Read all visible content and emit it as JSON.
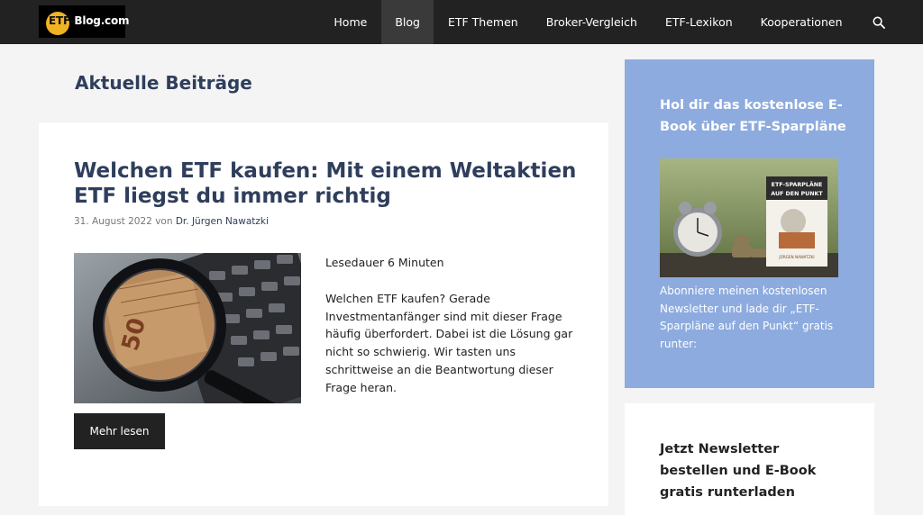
{
  "header": {
    "logo_prefix": "ETF-",
    "logo_suffix": "Blog.com",
    "nav": [
      {
        "label": "Home"
      },
      {
        "label": "Blog"
      },
      {
        "label": "ETF Themen"
      },
      {
        "label": "Broker-Vergleich"
      },
      {
        "label": "ETF-Lexikon"
      },
      {
        "label": "Kooperationen"
      }
    ],
    "active_nav": "Blog",
    "search_icon": "search-icon"
  },
  "main": {
    "page_title": "Aktuelle Beiträge",
    "post": {
      "title": "Welchen ETF kaufen: Mit einem Weltaktien ETF liegst du immer richtig",
      "date": "31. August 2022",
      "by": "von",
      "author": "Dr. Jürgen Nawatzki",
      "read_time": "Lesedauer 6 Minuten",
      "excerpt": "Welchen ETF kaufen? Gerade Investmentanfänger sind mit dieser Frage häufig überfordert. Dabei ist die Lösung gar nicht so schwierig. Wir tasten uns schrittweise an die Beantwortung dieser Frage heran.",
      "more_label": "Mehr lesen"
    }
  },
  "sidebar": {
    "ebook": {
      "title": "Hol dir das kostenlose E-Book über ETF-Sparpläne",
      "book_cover_line1": "ETF-SPARPLÄNE",
      "book_cover_line2": "AUF DEN PUNKT",
      "book_cover_author": "JÜRGEN NAWATZKI",
      "text": "Abonniere meinen kostenlosen Newsletter und lade dir „ETF-Sparpläne auf den Punkt“ gratis runter:"
    },
    "newsletter": {
      "title": "Jetzt Newsletter bestellen und E-Book gratis runterladen"
    }
  },
  "colors": {
    "topbar": "#222222",
    "heading": "#2f3e5c",
    "sidebar_box": "#8dabde",
    "logo_badge": "#f0b323"
  }
}
